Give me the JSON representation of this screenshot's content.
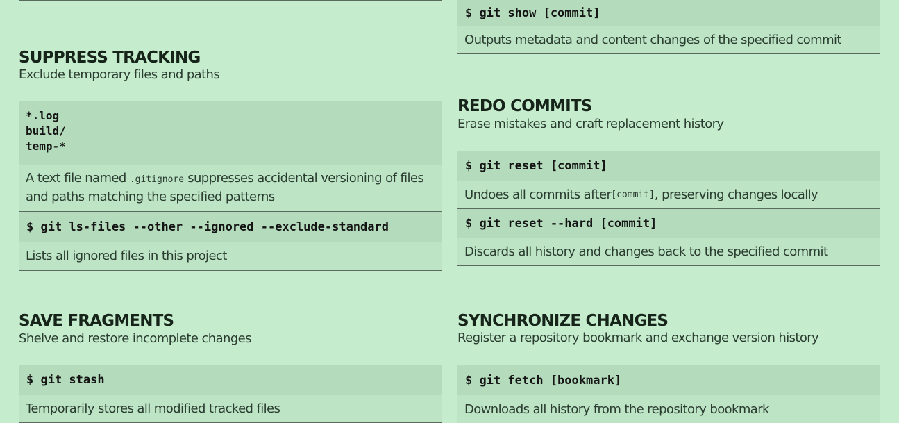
{
  "left": {
    "suppress": {
      "title": "SUPPRESS TRACKING",
      "subtitle": "Exclude temporary files and paths",
      "patterns": [
        "*.log",
        "build/",
        "temp-*"
      ],
      "gitignore_desc": {
        "before": "A text file named ",
        "code": ".gitignore",
        "after": " suppresses accidental versioning of files and paths matching the specified patterns"
      },
      "commands": [
        {
          "cmd": "$ git ls-files --other --ignored --exclude-standard",
          "desc": "Lists all ignored files in this project"
        }
      ]
    },
    "save": {
      "title": "SAVE FRAGMENTS",
      "subtitle": "Shelve and restore incomplete changes",
      "commands": [
        {
          "cmd": "$ git stash",
          "desc": "Temporarily stores all modified tracked files"
        }
      ]
    }
  },
  "right": {
    "top_command": {
      "cmd": "$ git show [commit]",
      "desc": "Outputs metadata and content changes of the specified commit"
    },
    "redo": {
      "title": "REDO COMMITS",
      "subtitle": "Erase mistakes and craft replacement history",
      "commands": [
        {
          "cmd": "$ git reset [commit]",
          "desc_before": "Undoes all commits after ",
          "desc_code": "[commit]",
          "desc_after": ", preserving changes locally"
        },
        {
          "cmd": "$ git reset --hard [commit]",
          "desc": "Discards all history and changes back to the specified commit"
        }
      ]
    },
    "sync": {
      "title": "SYNCHRONIZE CHANGES",
      "subtitle": "Register a repository bookmark and exchange version history",
      "commands": [
        {
          "cmd": "$ git fetch [bookmark]",
          "desc": "Downloads all history from the repository bookmark"
        }
      ]
    }
  }
}
